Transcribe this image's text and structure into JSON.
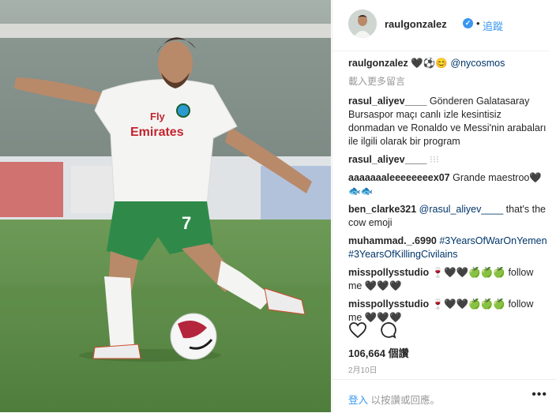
{
  "header": {
    "username": "raulgonzalez",
    "follow_separator": "•",
    "follow_label": "追蹤"
  },
  "caption": {
    "username": "raulgonzalez",
    "text": "🖤⚽😊",
    "mention": "@nycosmos"
  },
  "load_more_label": "載入更多留言",
  "comments": [
    {
      "user": "rasul_aliyev____",
      "text": "Gönderen Galatasaray Bursaspor maçı canlı izle kesintisiz donmadan ve Ronaldo ve Messi'nin arabaları ile ilgili olarak bir program"
    },
    {
      "user": "rasul_aliyev____",
      "text": "⁝⁝⁝"
    },
    {
      "user": "aaaaaaaleeeeeeeex07",
      "text": "Grande maestroo🖤 🐟🐟"
    },
    {
      "user": "ben_clarke321",
      "mention": "@rasul_aliyev____",
      "text": "that's the cow emoji"
    },
    {
      "user": "muhammad._.6990",
      "tags": "#3YearsOfWarOnYemen #3YearsOfKillingCivilains"
    },
    {
      "user": "misspollysstudio",
      "text": "🍷🖤🖤🍏🍏🍏 follow me 🖤🖤🖤"
    },
    {
      "user": "misspollysstudio",
      "text": "🍷🖤🖤🍏🍏🍏 follow me 🖤🖤🖤"
    }
  ],
  "likes": {
    "count": "106,664",
    "label": "個讚"
  },
  "date": "2月10日",
  "footer": {
    "login_link": "登入",
    "login_text": "以按讚或回應。",
    "more": "•••"
  },
  "photo": {
    "jersey_sponsor_line1": "Fly",
    "jersey_sponsor_line2": "Emirates",
    "jersey_number": "7"
  },
  "colors": {
    "accent": "#3897f0",
    "text": "#262626",
    "muted": "#999999",
    "link": "#003569"
  }
}
